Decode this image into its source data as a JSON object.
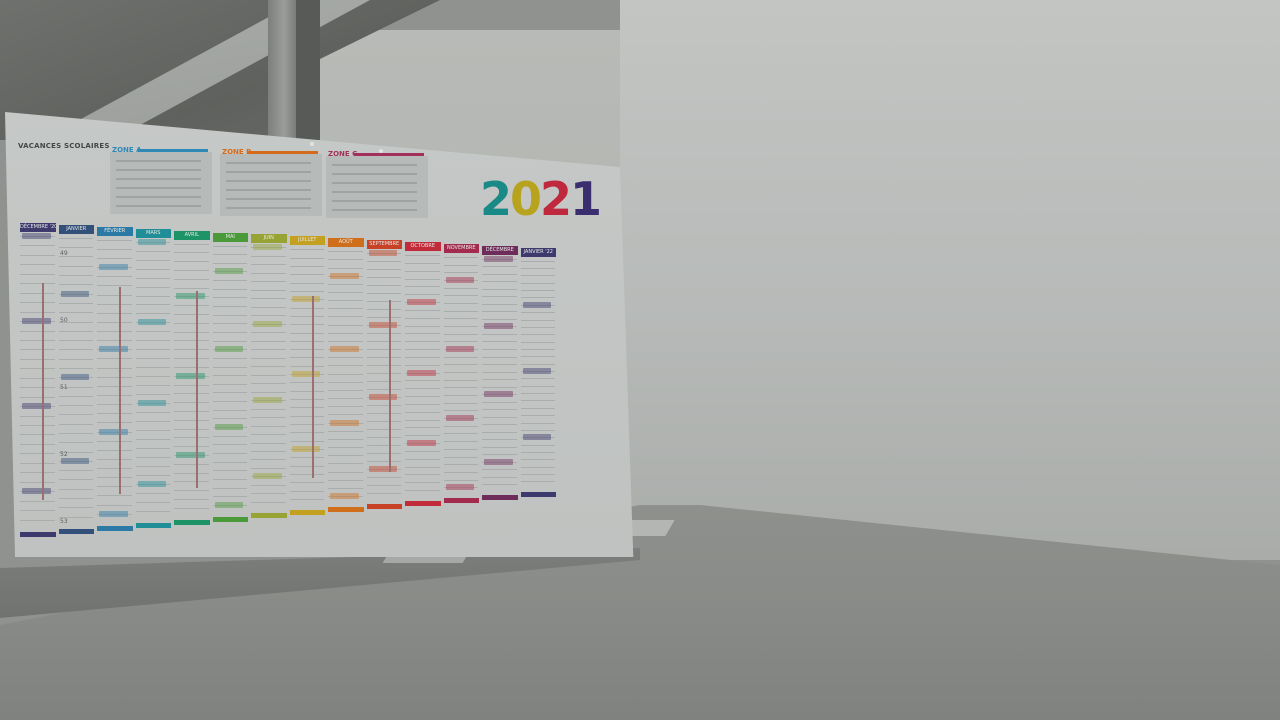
{
  "calendar": {
    "year": "2021",
    "year_digits": [
      {
        "char": "2",
        "color": "#1a8a86"
      },
      {
        "char": "0",
        "color": "#b8a31e"
      },
      {
        "char": "2",
        "color": "#c0283e"
      },
      {
        "char": "1",
        "color": "#3b2e6e"
      }
    ],
    "vacances_title": "VACANCES SCOLAIRES",
    "zones": [
      {
        "label": "ZONE A",
        "color": "#2f89b7"
      },
      {
        "label": "ZONE B",
        "color": "#d36a1c"
      },
      {
        "label": "ZONE C",
        "color": "#a3305a"
      }
    ],
    "months": [
      {
        "label": "DÉCEMBRE '20",
        "color": "#3f3a6e"
      },
      {
        "label": "JANVIER",
        "color": "#32507a"
      },
      {
        "label": "FÉVRIER",
        "color": "#2c79a6"
      },
      {
        "label": "MARS",
        "color": "#1f8e96"
      },
      {
        "label": "AVRIL",
        "color": "#1d9468"
      },
      {
        "label": "MAI",
        "color": "#4a9a3a"
      },
      {
        "label": "JUIN",
        "color": "#97a433"
      },
      {
        "label": "JUILLET",
        "color": "#c3a01e"
      },
      {
        "label": "AOÛT",
        "color": "#cf6f1c"
      },
      {
        "label": "SEPTEMBRE",
        "color": "#c84228"
      },
      {
        "label": "OCTOBRE",
        "color": "#c22b3a"
      },
      {
        "label": "NOVEMBRE",
        "color": "#a32c4e"
      },
      {
        "label": "DÉCEMBRE",
        "color": "#6e2c5a"
      },
      {
        "label": "JANVIER '22",
        "color": "#3e3a6e"
      }
    ],
    "week_numbers": [
      "49",
      "50",
      "51",
      "52",
      "53"
    ]
  }
}
